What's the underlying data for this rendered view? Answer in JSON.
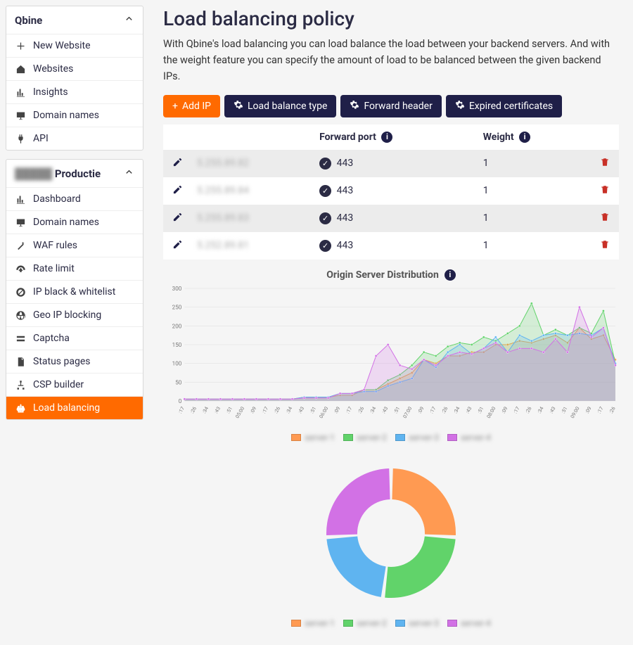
{
  "sidebar": {
    "group1": {
      "title": "Qbine",
      "items": [
        {
          "icon": "plus",
          "label": "New Website"
        },
        {
          "icon": "home",
          "label": "Websites"
        },
        {
          "icon": "chart",
          "label": "Insights"
        },
        {
          "icon": "monitor",
          "label": "Domain names"
        },
        {
          "icon": "plug",
          "label": "API"
        }
      ]
    },
    "group2": {
      "title_prefix": "█████",
      "title": "Productie",
      "items": [
        {
          "icon": "chart",
          "label": "Dashboard",
          "active": false
        },
        {
          "icon": "monitor",
          "label": "Domain names",
          "active": false
        },
        {
          "icon": "wand",
          "label": "WAF rules",
          "active": false
        },
        {
          "icon": "gauge",
          "label": "Rate limit",
          "active": false
        },
        {
          "icon": "ban",
          "label": "IP black & whitelist",
          "active": false
        },
        {
          "icon": "globe",
          "label": "Geo IP blocking",
          "active": false
        },
        {
          "icon": "captcha",
          "label": "Captcha",
          "active": false
        },
        {
          "icon": "doc",
          "label": "Status pages",
          "active": false
        },
        {
          "icon": "sitemap",
          "label": "CSP builder",
          "active": false
        },
        {
          "icon": "balance",
          "label": "Load balancing",
          "active": true
        }
      ]
    }
  },
  "page": {
    "title": "Load balancing policy",
    "description": "With Qbine's load balancing you can load balance the load between your backend servers. And with the weight feature you can specify the amount of load to be balanced between the given backend IPs."
  },
  "actions": {
    "add_ip": "Add IP",
    "load_balance_type": "Load balance type",
    "forward_header": "Forward header",
    "expired_certs": "Expired certificates"
  },
  "table": {
    "headers": {
      "forward_port": "Forward port",
      "weight": "Weight"
    },
    "rows": [
      {
        "ip": "5.255.89.82",
        "port": "443",
        "weight": "1"
      },
      {
        "ip": "5.255.89.84",
        "port": "443",
        "weight": "1"
      },
      {
        "ip": "5.255.89.83",
        "port": "443",
        "weight": "1"
      },
      {
        "ip": "5.252.89.81",
        "port": "443",
        "weight": "1"
      }
    ]
  },
  "dist_chart_title": "Origin Server Distribution",
  "chart_data": [
    {
      "type": "area",
      "title": "Origin Server Distribution",
      "ylabel": "",
      "xlabel": "",
      "ylim": [
        0,
        300
      ],
      "yticks": [
        0,
        50,
        100,
        150,
        200,
        250,
        300
      ],
      "x_labels": [
        ":17",
        ":26",
        ":34",
        ":43",
        ":51",
        "05:00",
        ":09",
        ":17",
        ":26",
        ":34",
        ":43",
        ":51",
        "06:00",
        ":09",
        ":17",
        ":26",
        ":34",
        ":43",
        ":51",
        "07:00",
        ":09",
        ":17",
        ":26",
        ":34",
        ":43",
        ":51",
        "08:00",
        ":09",
        ":17",
        ":26",
        ":34",
        ":43",
        ":51",
        "09:00",
        ":09",
        ":17",
        ":26"
      ],
      "series": [
        {
          "name": "server-1",
          "color": "#ff9a52",
          "values": [
            5,
            5,
            5,
            5,
            5,
            5,
            5,
            5,
            5,
            5,
            10,
            10,
            10,
            15,
            15,
            30,
            30,
            45,
            60,
            75,
            110,
            100,
            120,
            120,
            130,
            130,
            150,
            150,
            160,
            155,
            165,
            175,
            155,
            195,
            165,
            175,
            110
          ]
        },
        {
          "name": "server-2",
          "color": "#61d36a",
          "values": [
            5,
            5,
            5,
            5,
            5,
            5,
            5,
            5,
            5,
            5,
            10,
            10,
            10,
            20,
            20,
            30,
            30,
            55,
            70,
            95,
            130,
            120,
            145,
            155,
            150,
            170,
            160,
            180,
            200,
            260,
            175,
            190,
            175,
            195,
            180,
            240,
            100
          ]
        },
        {
          "name": "server-3",
          "color": "#5fb4f0",
          "values": [
            5,
            5,
            5,
            5,
            5,
            5,
            5,
            5,
            5,
            5,
            10,
            10,
            10,
            20,
            20,
            25,
            25,
            40,
            50,
            60,
            110,
            90,
            130,
            150,
            125,
            140,
            170,
            130,
            175,
            160,
            175,
            180,
            175,
            180,
            175,
            195,
            100
          ]
        },
        {
          "name": "server-4",
          "color": "#d271e5",
          "values": [
            5,
            5,
            5,
            5,
            5,
            5,
            5,
            5,
            5,
            5,
            8,
            8,
            8,
            20,
            20,
            30,
            120,
            150,
            95,
            85,
            110,
            95,
            120,
            130,
            125,
            140,
            155,
            130,
            140,
            140,
            130,
            165,
            130,
            250,
            170,
            195,
            95
          ]
        }
      ],
      "legend": [
        "server-1",
        "server-2",
        "server-3",
        "server-4"
      ]
    },
    {
      "type": "pie",
      "donut": true,
      "series": [
        {
          "name": "server-1",
          "color": "#ff9a52",
          "value": 26
        },
        {
          "name": "server-2",
          "color": "#61d36a",
          "value": 26
        },
        {
          "name": "server-3",
          "color": "#5fb4f0",
          "value": 22
        },
        {
          "name": "server-4",
          "color": "#d271e5",
          "value": 26
        }
      ],
      "legend": [
        "server-1",
        "server-2",
        "server-3",
        "server-4"
      ]
    }
  ]
}
